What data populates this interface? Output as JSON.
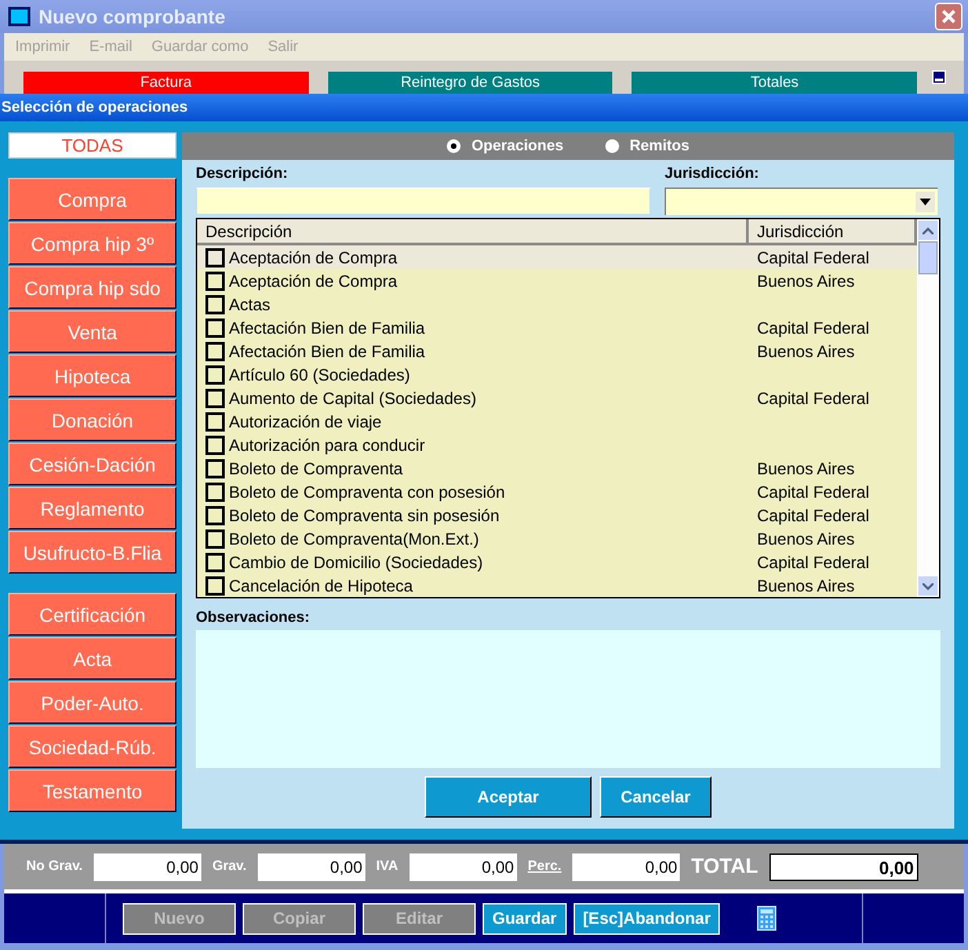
{
  "window": {
    "title": "Nuevo comprobante"
  },
  "menu": [
    {
      "label": "Imprimir",
      "disabled": true
    },
    {
      "label": "E-mail",
      "disabled": true
    },
    {
      "label": "Guardar como",
      "disabled": true
    },
    {
      "label": "Salir",
      "disabled": true
    }
  ],
  "tabs": [
    {
      "label": "Factura",
      "selected": true
    },
    {
      "label": "Reintegro de Gastos",
      "selected": false
    },
    {
      "label": "Totales",
      "selected": false
    }
  ],
  "dialog": {
    "title": "Selección de operaciones"
  },
  "sidebar": {
    "all_button": {
      "label": "TODAS",
      "selected": true
    },
    "groups": [
      {
        "items": [
          "Compra",
          "Compra hip 3º",
          "Compra hip sdo",
          "Venta",
          "Hipoteca",
          "Donación",
          "Cesión-Dación",
          "Reglamento",
          "Usufructo-B.Flia"
        ]
      },
      {
        "items": [
          "Certificación",
          "Acta",
          "Poder-Auto.",
          "Sociedad-Rúb.",
          "Testamento"
        ]
      }
    ]
  },
  "source_options": [
    {
      "label": "Operaciones",
      "selected": true
    },
    {
      "label": "Remitos",
      "selected": false
    }
  ],
  "filters": {
    "description_label": "Descripción:",
    "jurisdiction_label": "Jurisdicción:"
  },
  "table": {
    "columns": [
      "Descripción",
      "Jurisdicción"
    ],
    "rows": [
      {
        "description": "Aceptación de Compra",
        "jurisdiction": "Capital Federal",
        "checked": false,
        "selected": true
      },
      {
        "description": "Aceptación de Compra",
        "jurisdiction": "Buenos Aires",
        "checked": false,
        "selected": false
      },
      {
        "description": "Actas",
        "jurisdiction": "",
        "checked": false,
        "selected": false
      },
      {
        "description": "Afectación Bien de Familia",
        "jurisdiction": "Capital Federal",
        "checked": false,
        "selected": false
      },
      {
        "description": "Afectación Bien de Familia",
        "jurisdiction": "Buenos Aires",
        "checked": false,
        "selected": false
      },
      {
        "description": "Artículo 60 (Sociedades)",
        "jurisdiction": "",
        "checked": false,
        "selected": false
      },
      {
        "description": "Aumento de Capital (Sociedades)",
        "jurisdiction": "Capital Federal",
        "checked": false,
        "selected": false
      },
      {
        "description": "Autorización de viaje",
        "jurisdiction": "",
        "checked": false,
        "selected": false
      },
      {
        "description": "Autorización para conducir",
        "jurisdiction": "",
        "checked": false,
        "selected": false
      },
      {
        "description": "Boleto de Compraventa",
        "jurisdiction": "Buenos Aires",
        "checked": false,
        "selected": false
      },
      {
        "description": "Boleto de Compraventa con posesión",
        "jurisdiction": "Capital Federal",
        "checked": false,
        "selected": false
      },
      {
        "description": "Boleto de Compraventa sin posesión",
        "jurisdiction": "Capital Federal",
        "checked": false,
        "selected": false
      },
      {
        "description": "Boleto de Compraventa(Mon.Ext.)",
        "jurisdiction": "Buenos Aires",
        "checked": false,
        "selected": false
      },
      {
        "description": "Cambio de Domicilio (Sociedades)",
        "jurisdiction": "Capital Federal",
        "checked": false,
        "selected": false
      },
      {
        "description": "Cancelación de Hipoteca",
        "jurisdiction": "Buenos Aires",
        "checked": false,
        "selected": false
      }
    ]
  },
  "observations_label": "Observaciones:",
  "dialog_buttons": [
    "Aceptar",
    "Cancelar"
  ],
  "totals": [
    {
      "label": "No Grav.",
      "value": "0,00",
      "kind": "plain"
    },
    {
      "label": "Grav.",
      "value": "0,00",
      "kind": "plain"
    },
    {
      "label": "IVA",
      "value": "0,00",
      "kind": "plain"
    },
    {
      "label": "Perc.",
      "value": "0,00",
      "kind": "link"
    }
  ],
  "total": {
    "label": "TOTAL",
    "value": "0,00"
  },
  "actions": [
    {
      "label": "Nuevo",
      "disabled": true
    },
    {
      "label": "Copiar",
      "disabled": true
    },
    {
      "label": "Editar",
      "disabled": true
    },
    {
      "label": "Guardar",
      "disabled": false
    },
    {
      "label": "[Esc]Abandonar",
      "disabled": false
    }
  ]
}
